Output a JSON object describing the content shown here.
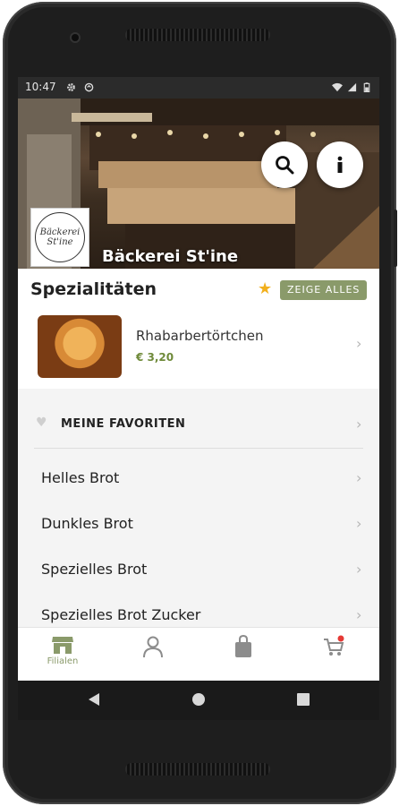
{
  "statusbar": {
    "time": "10:47"
  },
  "header": {
    "shop_name": "Bäckerei St'ine",
    "logo_text": "Bäckerei St'ine"
  },
  "specials": {
    "title": "Spezialitäten",
    "show_all_label": "ZEIGE ALLES",
    "item": {
      "name": "Rhabarbertörtchen",
      "price": "€ 3,20"
    }
  },
  "favorites": {
    "label": "MEINE FAVORITEN"
  },
  "categories": [
    {
      "label": "Helles Brot"
    },
    {
      "label": "Dunkles Brot"
    },
    {
      "label": "Spezielles Brot"
    },
    {
      "label": "Spezielles Brot Zucker"
    }
  ],
  "bottom_nav": {
    "items": [
      {
        "label": "Filialen",
        "icon": "store-icon",
        "active": true
      },
      {
        "label": "",
        "icon": "user-icon"
      },
      {
        "label": "",
        "icon": "shopping-bag-icon"
      },
      {
        "label": "",
        "icon": "cart-icon",
        "badge": true
      }
    ]
  },
  "colors": {
    "accent": "#8a9a6a",
    "price": "#6f8a3a",
    "star": "#f2b01e",
    "badge": "#e53935"
  }
}
